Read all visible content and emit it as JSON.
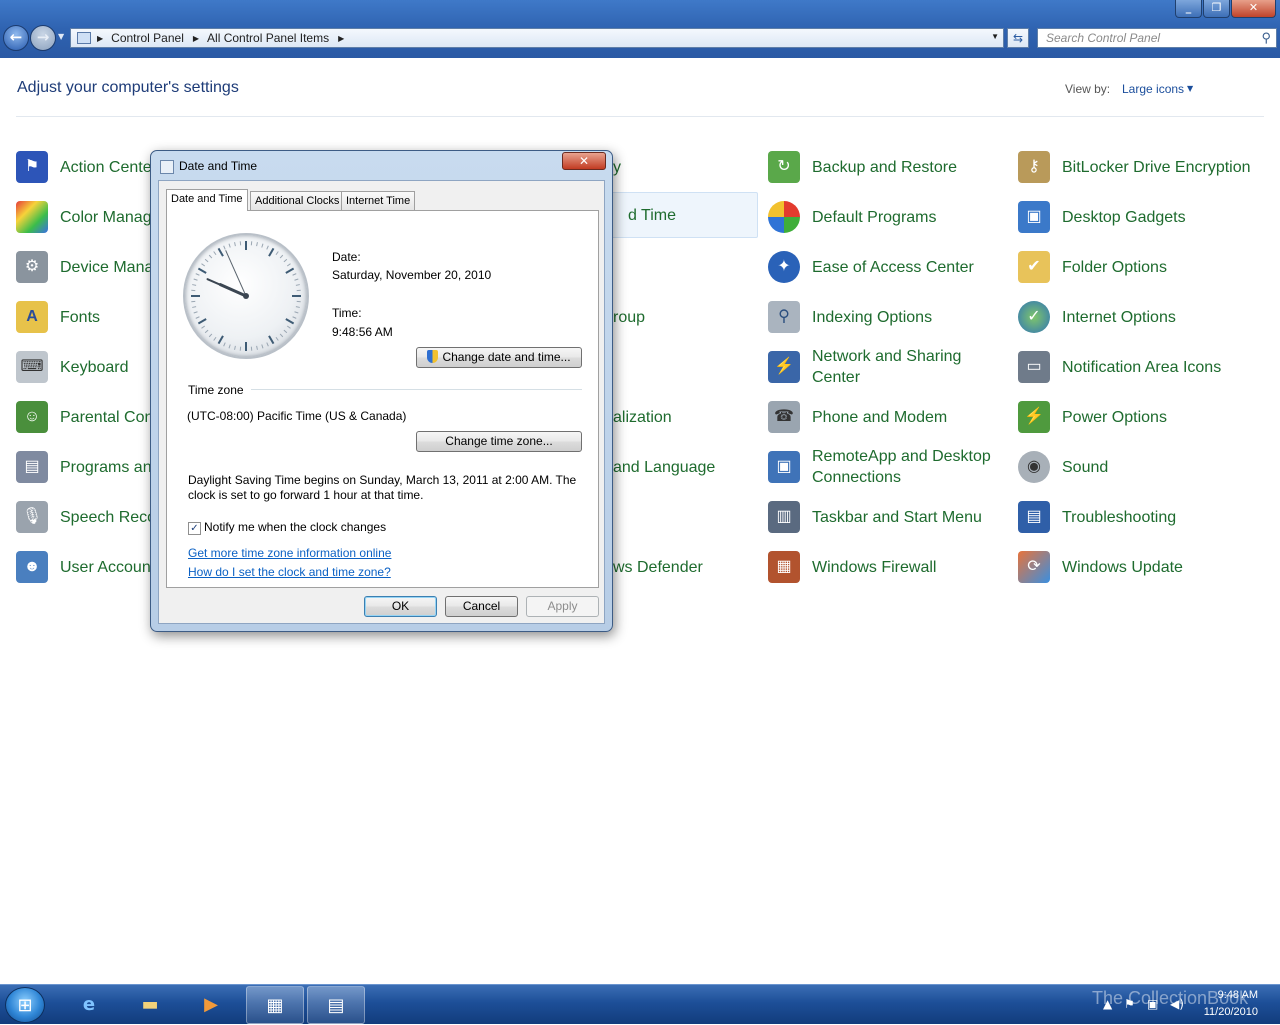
{
  "explorer": {
    "breadcrumbs": [
      "Control Panel",
      "All Control Panel Items"
    ],
    "search_placeholder": "Search Control Panel",
    "header": "Adjust your computer's settings",
    "viewby_label": "View by:",
    "viewby_value": "Large icons"
  },
  "cp_items": [
    {
      "label": "Action Cente"
    },
    {
      "label": "Color Manag"
    },
    {
      "label": "Device Mana"
    },
    {
      "label": "Fonts"
    },
    {
      "label": "Keyboard"
    },
    {
      "label": "Parental Con"
    },
    {
      "label": "Programs an"
    },
    {
      "label": "Speech Reco"
    },
    {
      "label": "User Accoun"
    },
    {
      "label": "y"
    },
    {
      "label": "d Time"
    },
    {
      "label": "roup"
    },
    {
      "label": "alization"
    },
    {
      "label": "and Language"
    },
    {
      "label": "ws Defender"
    },
    {
      "label": "Backup and Restore"
    },
    {
      "label": "Default Programs"
    },
    {
      "label": "Ease of Access Center"
    },
    {
      "label": "Indexing Options"
    },
    {
      "label": "Network and Sharing Center"
    },
    {
      "label": "Phone and Modem"
    },
    {
      "label": "RemoteApp and Desktop Connections"
    },
    {
      "label": "Taskbar and Start Menu"
    },
    {
      "label": "Windows Firewall"
    },
    {
      "label": "BitLocker Drive Encryption"
    },
    {
      "label": "Desktop Gadgets"
    },
    {
      "label": "Folder Options"
    },
    {
      "label": "Internet Options"
    },
    {
      "label": "Notification Area Icons"
    },
    {
      "label": "Power Options"
    },
    {
      "label": "Sound"
    },
    {
      "label": "Troubleshooting"
    },
    {
      "label": "Windows Update"
    }
  ],
  "dialog": {
    "title": "Date and Time",
    "tabs": [
      "Date and Time",
      "Additional Clocks",
      "Internet Time"
    ],
    "date_label": "Date:",
    "date_value": "Saturday, November 20, 2010",
    "time_label": "Time:",
    "time_value": "9:48:56 AM",
    "clock": {
      "hour": 9,
      "minute": 48,
      "second": 56
    },
    "change_datetime_btn": "Change date and time...",
    "timezone_heading": "Time zone",
    "timezone_value": "(UTC-08:00) Pacific Time (US & Canada)",
    "change_timezone_btn": "Change time zone...",
    "dst_line1": "Daylight Saving Time begins on Sunday, March 13, 2011 at 2:00 AM. The",
    "dst_line2": "clock is set to go forward 1 hour at that time.",
    "notify_label": "Notify me when the clock changes",
    "notify_checked": true,
    "link1": "Get more time zone information online",
    "link2": "How do I set the clock and time zone?",
    "ok": "OK",
    "cancel": "Cancel",
    "apply": "Apply"
  },
  "taskbar": {
    "watermark": "The CollectionBook",
    "time": "9:48 AM",
    "date": "11/20/2010"
  },
  "colors": {
    "link_green": "#1e6b2e",
    "accent_blue": "#2f63b1"
  }
}
